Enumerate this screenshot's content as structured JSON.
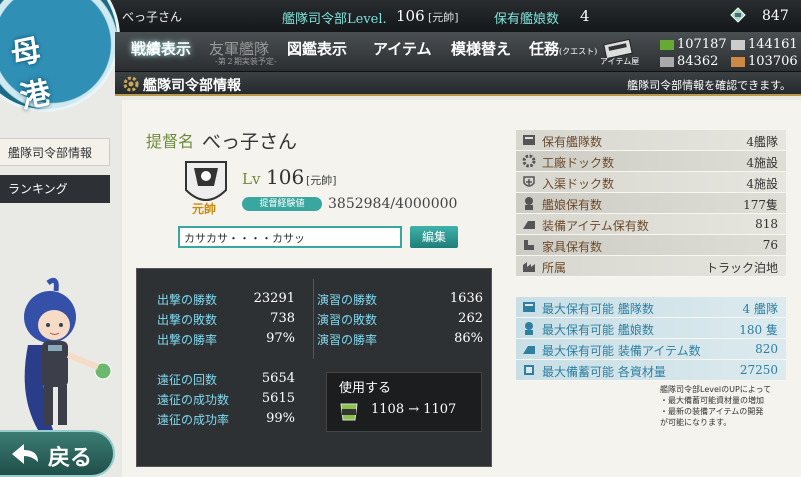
{
  "colors": {
    "accent": "#3aa6a0",
    "stat_label": "#7fd9ef",
    "info_label": "#6b4a2a",
    "max_label": "#2f7fa0",
    "rank_gold": "#c98a10"
  },
  "emblem": {
    "text": "母港"
  },
  "topbar": {
    "player_name": "べっ子さん",
    "hq_level_label": "艦隊司令部Level.",
    "hq_level": "106",
    "hq_rank": "[元帥]",
    "ships_label": "保有艦娘数",
    "ships_count": "4",
    "coins": "847"
  },
  "menu": {
    "items": [
      {
        "label": "戦績表示"
      },
      {
        "label": "友軍艦隊",
        "sub": "-第２期実装予定-"
      },
      {
        "label": "図鑑表示"
      },
      {
        "label": "アイテム"
      },
      {
        "label": "模様替え"
      },
      {
        "label": "任務",
        "sub": "(クエスト)"
      }
    ],
    "item_shop_label": "アイテム屋"
  },
  "resources": {
    "fuel": "107187",
    "ammo": "144161",
    "steel": "84362",
    "bauxite": "103706"
  },
  "section": {
    "title": "艦隊司令部情報",
    "hint": "艦隊司令部情報を確認できます。"
  },
  "sidenav": [
    {
      "label": "艦隊司令部情報"
    },
    {
      "label": "ランキング"
    }
  ],
  "back_button": {
    "label": "戻る"
  },
  "profile": {
    "admiral_label": "提督名",
    "name": "べっ子さん",
    "rank_emblem_text": "元帥",
    "lv_label": "Lv",
    "level": "106",
    "rank": "[元帥]",
    "exp_badge": "提督経験値",
    "exp": "3852984/4000000",
    "comment": "カサカサ・・・・カサッ",
    "edit_label": "編集"
  },
  "battle_stats": {
    "sortie": [
      {
        "label": "出撃の勝数",
        "value": "23291"
      },
      {
        "label": "出撃の敗数",
        "value": "738"
      },
      {
        "label": "出撃の勝率",
        "value": "97%"
      }
    ],
    "practice": [
      {
        "label": "演習の勝数",
        "value": "1636"
      },
      {
        "label": "演習の敗数",
        "value": "262"
      },
      {
        "label": "演習の勝率",
        "value": "86%"
      }
    ],
    "expedition": [
      {
        "label": "遠征の回数",
        "value": "5654"
      },
      {
        "label": "遠征の成功数",
        "value": "5615"
      },
      {
        "label": "遠征の成功率",
        "value": "99%"
      }
    ]
  },
  "repair": {
    "title": "使用する",
    "icon_label": "修復",
    "value": "1108 → 1107"
  },
  "info": [
    {
      "label": "保有艦隊数",
      "value": "4艦隊",
      "icon": "fleet-icon"
    },
    {
      "label": "工廠ドック数",
      "value": "4施設",
      "icon": "gear-icon"
    },
    {
      "label": "入渠ドック数",
      "value": "4施設",
      "icon": "repair-icon"
    },
    {
      "label": "艦娘保有数",
      "value": "177隻",
      "icon": "shipgirl-icon"
    },
    {
      "label": "装備アイテム保有数",
      "value": "818",
      "icon": "equipment-icon"
    },
    {
      "label": "家具保有数",
      "value": "76",
      "icon": "furniture-icon"
    },
    {
      "label": "所属",
      "value": "トラック泊地",
      "icon": "base-icon"
    }
  ],
  "max_info": [
    {
      "label": "最大保有可能 艦隊数",
      "value": "4 艦隊"
    },
    {
      "label": "最大保有可能 艦娘数",
      "value": "180 隻"
    },
    {
      "label": "最大保有可能 装備アイテム数",
      "value": "820"
    },
    {
      "label": "最大備蓄可能 各資材量",
      "value": "27250"
    }
  ],
  "note": {
    "line1": "艦隊司令部LevelのUPによって",
    "line2": "・最大備蓄可能資材量の増加",
    "line3": "・最新の装備アイテムの開発",
    "line4": "が可能になります。"
  }
}
